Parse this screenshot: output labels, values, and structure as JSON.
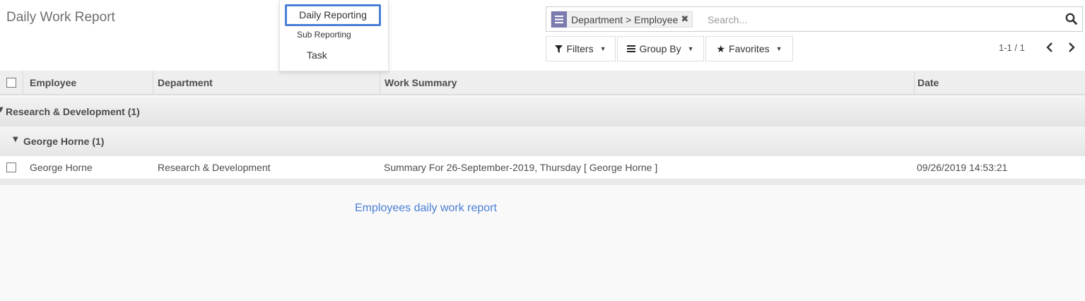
{
  "page": {
    "title": "Daily Work Report",
    "help_text": "Employees daily work report"
  },
  "dropdown": {
    "items": [
      "Daily Reporting",
      "Sub Reporting",
      "Task"
    ],
    "active_index": 0
  },
  "search": {
    "facet_label": "Department > Employee",
    "facet_icon": "list-icon",
    "placeholder": "Search...",
    "value": ""
  },
  "toolbar": {
    "filters_label": "Filters",
    "groupby_label": "Group By",
    "favorites_label": "Favorites"
  },
  "pager": {
    "label": "1-1 / 1"
  },
  "table": {
    "columns": [
      "Employee",
      "Department",
      "Work Summary",
      "Date"
    ],
    "groups": [
      {
        "label": "Research & Development (1)",
        "subgroups": [
          {
            "label": "George Horne (1)",
            "rows": [
              {
                "employee": "George Horne",
                "department": "Research & Development",
                "summary": "Summary For 26-September-2019, Thursday [ George Horne ]",
                "date": "09/26/2019 14:53:21"
              }
            ]
          }
        ]
      }
    ]
  },
  "colors": {
    "accent": "#4a7fd6",
    "facet": "#7c7bad"
  }
}
